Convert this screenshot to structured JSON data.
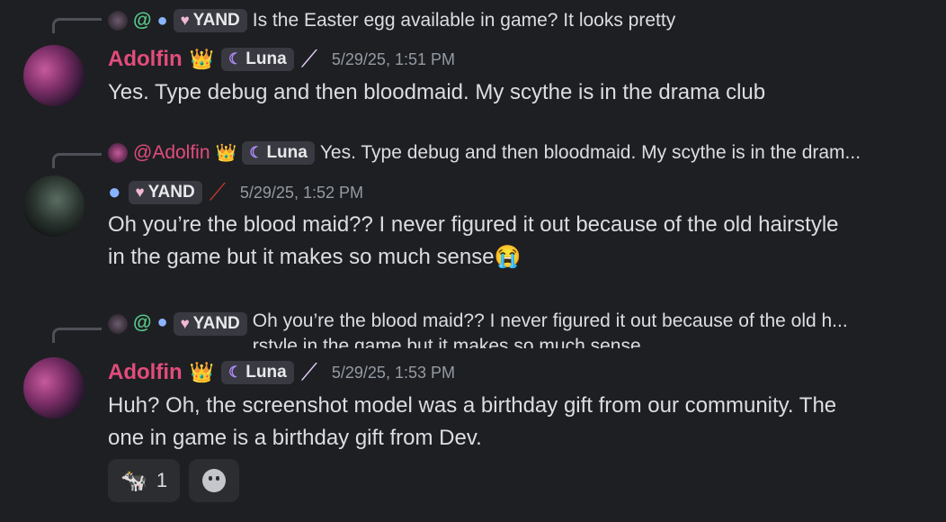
{
  "messages": [
    {
      "reply": {
        "prefix": "@",
        "tag": "YAND",
        "text": "Is the Easter egg available in game? It looks pretty"
      },
      "author": "Adolfin",
      "crown": "👑",
      "tag": "Luna",
      "timestamp": "5/29/25, 1:51 PM",
      "content": "Yes. Type debug and then bloodmaid. My scythe is in the drama club"
    },
    {
      "reply": {
        "prefix": "@Adolfin",
        "crown": "👑",
        "tag": "Luna",
        "text": "Yes. Type debug and then bloodmaid. My scythe is in the dram..."
      },
      "tag": "YAND",
      "timestamp": "5/29/25, 1:52 PM",
      "content_line1": "Oh you’re the blood maid?? I never figured it out because of the old hairstyle",
      "content_line2": "in the game but it makes so much sense",
      "emoji": "😭"
    },
    {
      "reply": {
        "prefix": "@",
        "tag": "YAND",
        "text_line1": "Oh you’re the blood maid?? I never figured it out because of the old h...",
        "text_line2": "rstyle in the game but it makes so much sense"
      },
      "author": "Adolfin",
      "crown": "👑",
      "tag": "Luna",
      "timestamp": "5/29/25, 1:53 PM",
      "content_line1": "Huh? Oh, the screenshot model was a birthday gift from our community. The",
      "content_line2": "one in game is a birthday gift from Dev.",
      "reaction": {
        "emoji": "🐄",
        "count": "1"
      }
    }
  ],
  "colors": {
    "background": "#1e1f22",
    "username": "#e24c7c",
    "timestamp": "#949ba4",
    "tag_bg": "#393a41"
  }
}
